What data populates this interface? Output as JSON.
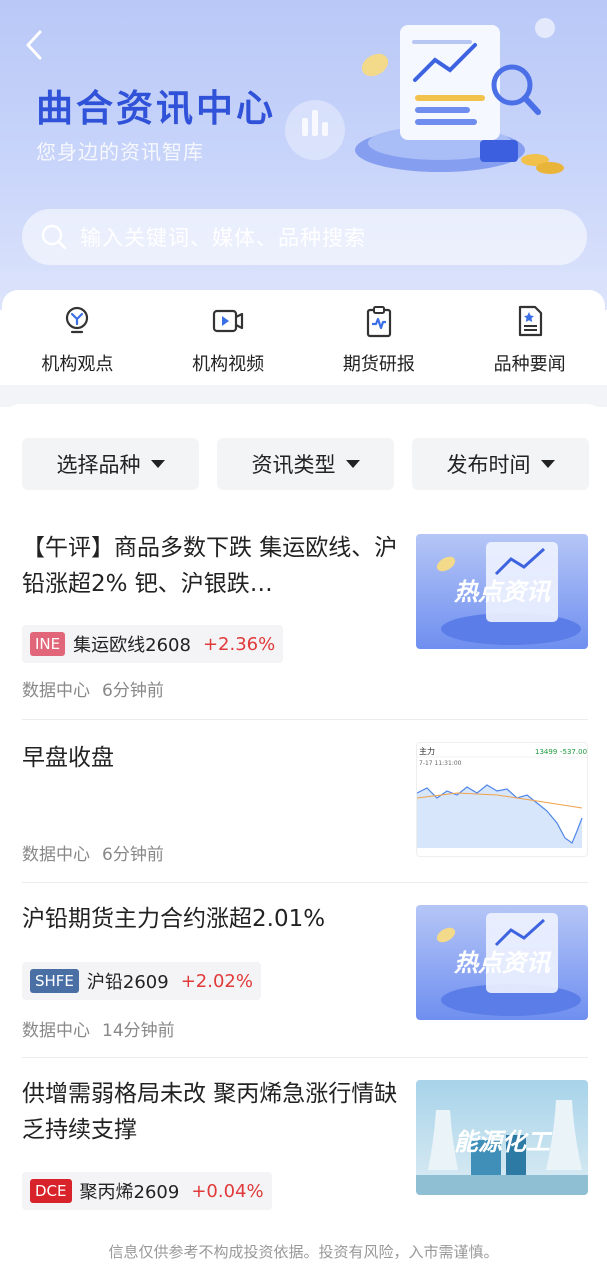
{
  "header": {
    "title": "曲合资讯中心",
    "subtitle": "您身边的资讯智库"
  },
  "search": {
    "placeholder": "输入关键词、媒体、品种搜索"
  },
  "quick_nav": [
    {
      "label": "机构观点",
      "icon": "lightbulb-icon"
    },
    {
      "label": "机构视频",
      "icon": "video-icon"
    },
    {
      "label": "期货研报",
      "icon": "clipboard-chart-icon"
    },
    {
      "label": "品种要闻",
      "icon": "document-star-icon"
    }
  ],
  "filters": [
    {
      "label": "选择品种"
    },
    {
      "label": "资讯类型"
    },
    {
      "label": "发布时间"
    }
  ],
  "news": [
    {
      "title": "【午评】商品多数下跌  集运欧线、沪铅涨超2%  钯、沪银跌…",
      "exchange": "INE",
      "contract": "集运欧线2608",
      "change": "+2.36%",
      "source": "数据中心",
      "time": "6分钟前",
      "thumb_text": "热点资讯"
    },
    {
      "title": "早盘收盘",
      "source": "数据中心",
      "time": "6分钟前",
      "chart_thumb": {
        "label": "主力",
        "date": "7-17 11:31:00",
        "price": "13499",
        "change": "-537.00"
      }
    },
    {
      "title": "沪铅期货主力合约涨超2.01%",
      "exchange": "SHFE",
      "contract": "沪铅2609",
      "change": "+2.02%",
      "source": "数据中心",
      "time": "14分钟前",
      "thumb_text": "热点资讯"
    },
    {
      "title": "供增需弱格局未改 聚丙烯急涨行情缺乏持续支撑",
      "exchange": "DCE",
      "contract": "聚丙烯2609",
      "change": "+0.04%",
      "thumb_text": "能源化工"
    }
  ],
  "footer": {
    "disclaimer": "信息仅供参考不构成投资依据。投资有风险，入市需谨慎。"
  },
  "colors": {
    "brand_blue": "#2f52d8",
    "rise_red": "#e03a3a",
    "ine_badge": "#e2667a",
    "shfe_badge": "#4a6fa5",
    "dce_badge": "#d8232a"
  }
}
